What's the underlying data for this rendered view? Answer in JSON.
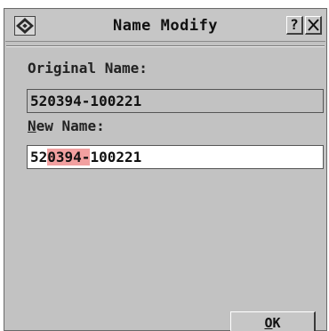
{
  "window": {
    "title": "Name Modify",
    "help_label": "?",
    "icons": {
      "app": "diamond-logo-icon",
      "close": "close-icon"
    }
  },
  "form": {
    "original_label": "Original Name:",
    "original_value": "520394-100221",
    "new_label_mnemonic": "N",
    "new_label_rest": "ew Name:",
    "new_value_before": "52",
    "new_value_selected": "0394-",
    "new_value_after": "100221"
  },
  "buttons": {
    "ok_mnemonic": "O",
    "ok_rest": "K"
  },
  "colors": {
    "selection": "#f2a0a0",
    "dialog_bg": "#c2c2c2",
    "input_bg": "#ffffff"
  }
}
